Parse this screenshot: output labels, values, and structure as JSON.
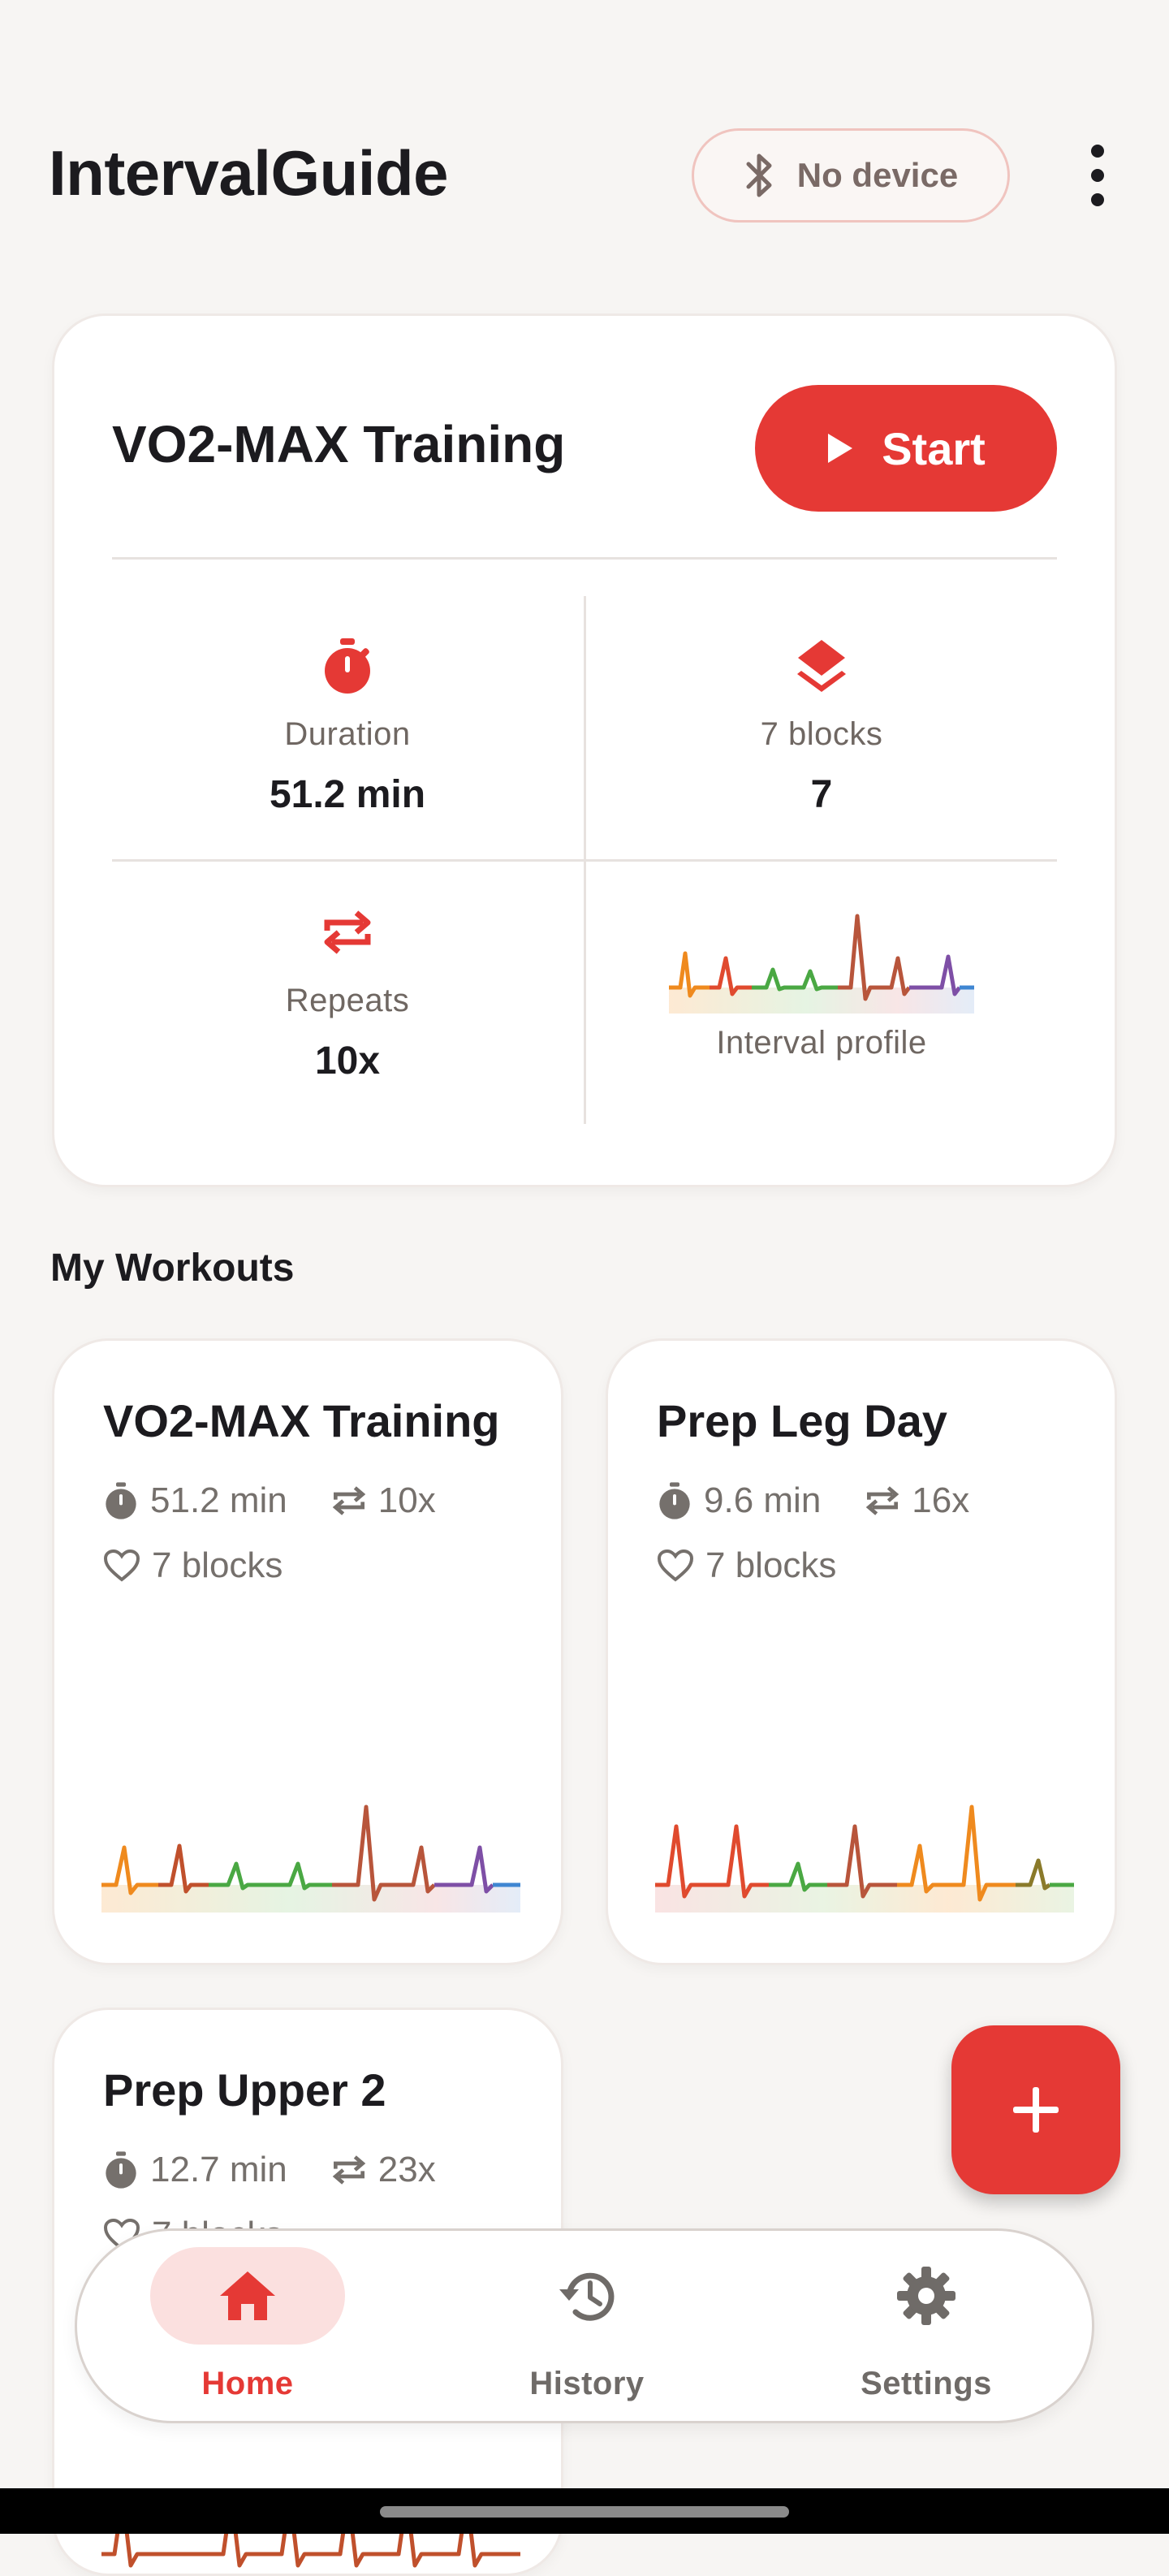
{
  "app": {
    "title": "IntervalGuide",
    "device_status": "No device"
  },
  "featured": {
    "title": "VO2-MAX Training",
    "start_label": "Start",
    "stats": {
      "duration_label": "Duration",
      "duration_value": "51.2 min",
      "blocks_label": "7 blocks",
      "blocks_value": "7",
      "repeats_label": "Repeats",
      "repeats_value": "10x",
      "profile_label": "Interval profile"
    }
  },
  "section_title": "My Workouts",
  "workouts": [
    {
      "title": "VO2-MAX Training",
      "duration": "51.2 min",
      "repeats": "10x",
      "blocks": "7 blocks"
    },
    {
      "title": "Prep Leg Day",
      "duration": "9.6 min",
      "repeats": "16x",
      "blocks": "7 blocks"
    },
    {
      "title": "Prep Upper 2",
      "duration": "12.7 min",
      "repeats": "23x",
      "blocks": "7 blocks"
    }
  ],
  "nav": {
    "home": "Home",
    "history": "History",
    "settings": "Settings",
    "active": "Home"
  },
  "icons": [
    "bluetooth-icon",
    "more-vert-icon",
    "play-icon",
    "timer-icon",
    "layers-icon",
    "repeat-icon",
    "heart-icon",
    "plus-icon",
    "home-icon",
    "history-icon",
    "settings-icon"
  ],
  "colors": {
    "accent": "#e53935",
    "background": "#f7f5f3",
    "card": "#ffffff",
    "muted_text": "#75706c"
  }
}
